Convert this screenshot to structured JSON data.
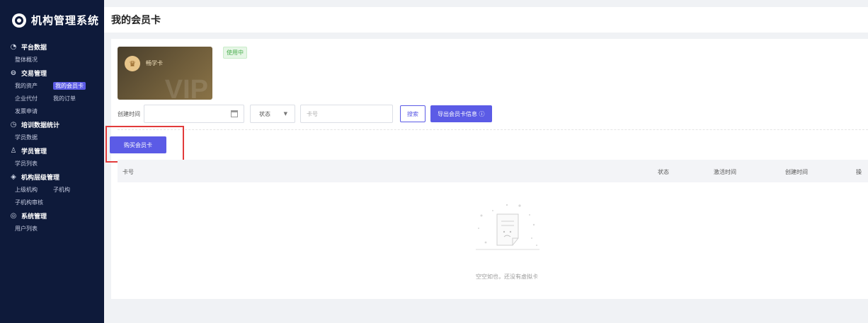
{
  "app": {
    "title": "机构管理系统"
  },
  "sidebar": {
    "groups": [
      {
        "title": "平台数据",
        "icon": "chart-circle-icon",
        "items": [
          "整体概况"
        ]
      },
      {
        "title": "交易管理",
        "icon": "minus-circle-icon",
        "items": [
          "我的资产",
          "我的会员卡",
          "企业代付",
          "我的订单",
          "发票申请"
        ],
        "active": "我的会员卡"
      },
      {
        "title": "培训数据统计",
        "icon": "clock-circle-icon",
        "items": [
          "学员数据"
        ]
      },
      {
        "title": "学员管理",
        "icon": "user-icon",
        "items": [
          "学员列表"
        ]
      },
      {
        "title": "机构层级管理",
        "icon": "layers-icon",
        "items": [
          "上级机构",
          "子机构",
          "子机构审核"
        ]
      },
      {
        "title": "系统管理",
        "icon": "settings-circle-icon",
        "items": [
          "用户列表"
        ]
      }
    ]
  },
  "header": {
    "title": "我的会员卡"
  },
  "card": {
    "name": "畅学卡",
    "watermark": "VIP",
    "status": "使用中"
  },
  "filters": {
    "date_label": "创建时间",
    "status_label": "状态",
    "card_no_placeholder": "卡号",
    "search_label": "搜索",
    "export_label": "导出会员卡信息 ⓘ"
  },
  "actions": {
    "buy_label": "购买会员卡"
  },
  "table": {
    "columns": [
      "卡号",
      "状态",
      "激活时间",
      "创建时间",
      "操"
    ]
  },
  "empty": {
    "text": "空空如也，还没有虚拟卡"
  },
  "colors": {
    "primary": "#5b5be6",
    "sidebar": "#0e1a3a",
    "highlight": "#e23b3b"
  }
}
